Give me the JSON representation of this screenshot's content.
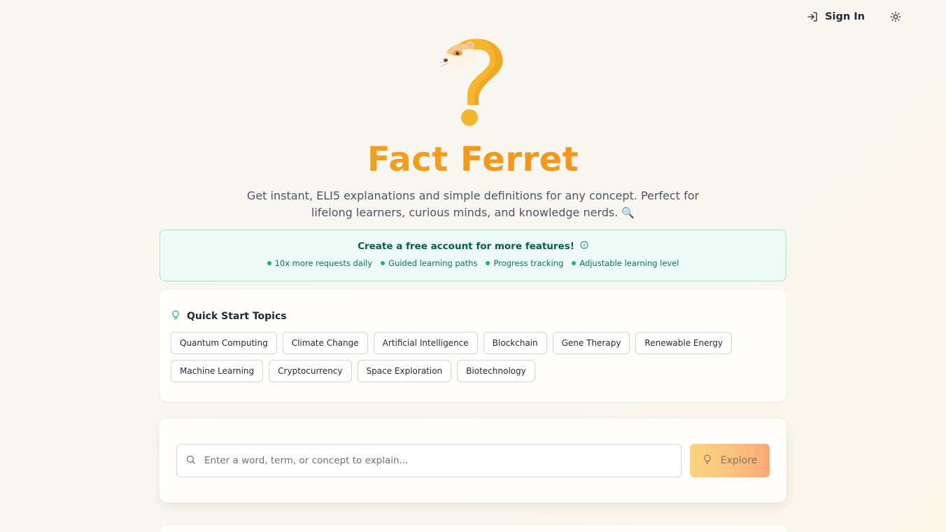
{
  "header": {
    "sign_in_label": "Sign In",
    "sign_in_icon": "login-arrow-icon",
    "theme_icon": "sun-icon"
  },
  "hero": {
    "logo_icon": "ferret-question-mark-logo",
    "title": "Fact Ferret",
    "subtitle_line1": "Get instant, ELI5 explanations and simple definitions for any concept. Perfect for",
    "subtitle_line2": "lifelong learners, curious minds, and knowledge nerds.",
    "subtitle_emoji": "🔍"
  },
  "promo": {
    "title": "Create a free account for more features!",
    "info_icon": "info-icon",
    "features": [
      "10x more requests daily",
      "Guided learning paths",
      "Progress tracking",
      "Adjustable learning level"
    ]
  },
  "quick_start": {
    "heading": "Quick Start Topics",
    "icon": "lightbulb-icon",
    "topics": [
      "Quantum Computing",
      "Climate Change",
      "Artificial Intelligence",
      "Blockchain",
      "Gene Therapy",
      "Renewable Energy",
      "Machine Learning",
      "Cryptocurrency",
      "Space Exploration",
      "Biotechnology"
    ]
  },
  "search": {
    "placeholder": "Enter a word, term, or concept to explain...",
    "value": "",
    "search_icon": "search-icon",
    "button_label": "Explore",
    "button_icon": "lightbulb-icon"
  },
  "colors": {
    "brand_start": "#f0b324",
    "brand_end": "#f28a14",
    "promo_bg": "#effbf6",
    "promo_text": "#065f46",
    "accent_green": "#10b981"
  }
}
